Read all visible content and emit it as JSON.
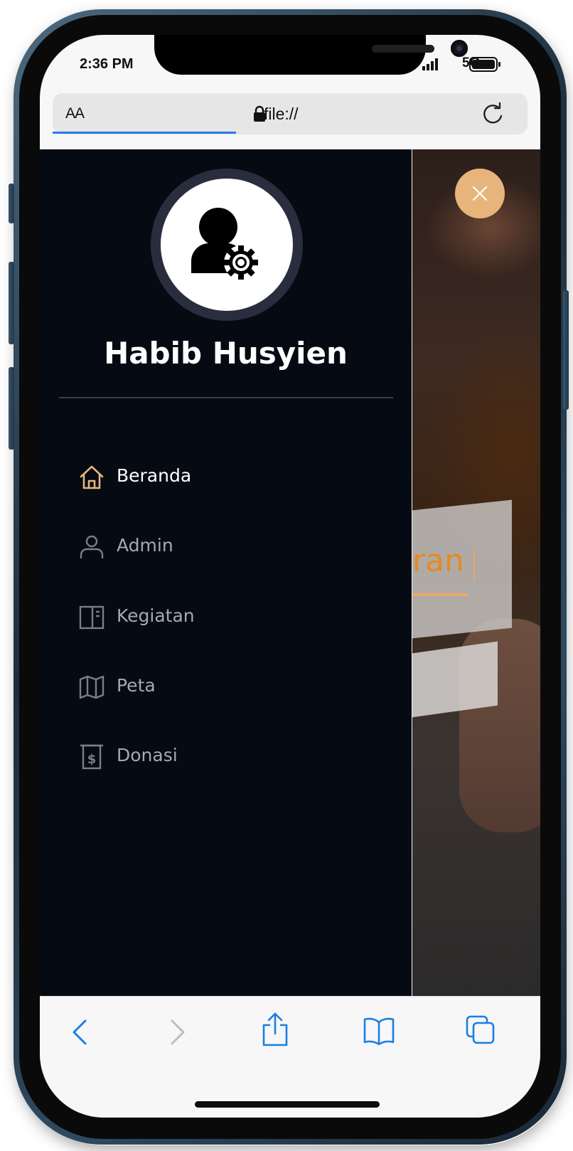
{
  "status_bar": {
    "time": "2:36 PM",
    "network": "5G"
  },
  "browser": {
    "text_size_label": "AA",
    "url": "file://",
    "load_progress": 0.38,
    "accent_color": "#2a7be4"
  },
  "page": {
    "background_text": "ran",
    "close_button_color": "#e7b57b",
    "sidebar": {
      "user_name": "Habib Husyien",
      "menu": [
        {
          "label": "Beranda",
          "icon": "home-icon",
          "active": true
        },
        {
          "label": "Admin",
          "icon": "user-icon",
          "active": false
        },
        {
          "label": "Kegiatan",
          "icon": "layout-icon",
          "active": false
        },
        {
          "label": "Peta",
          "icon": "map-icon",
          "active": false
        },
        {
          "label": "Donasi",
          "icon": "receipt-dollar-icon",
          "active": false
        }
      ],
      "background_color": "#060a13",
      "active_icon_color": "#e7b57b"
    }
  },
  "toolbar": {
    "items": [
      "back-icon",
      "forward-icon",
      "share-icon",
      "bookmarks-icon",
      "tabs-icon"
    ]
  }
}
